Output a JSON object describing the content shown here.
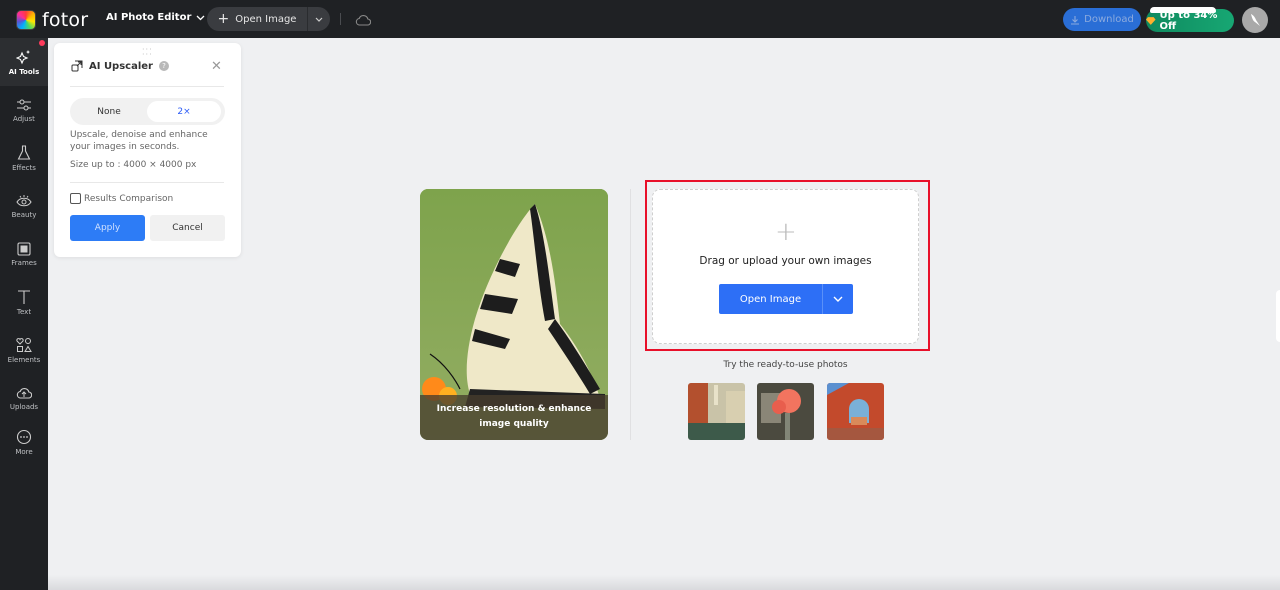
{
  "topbar": {
    "logo_text": "fotor",
    "app_menu_label": "AI Photo Editor",
    "open_image_label": "Open Image",
    "download_label": "Download",
    "promo_label": "Up to 34% Off",
    "icons": [
      "plus-icon",
      "chevron-down-icon",
      "cloud-icon",
      "download-icon",
      "diamond-icon",
      "avatar-bird-icon"
    ]
  },
  "sidebar": {
    "items": [
      {
        "label": "AI Tools",
        "icon": "sparkle-icon",
        "active": true
      },
      {
        "label": "Adjust",
        "icon": "sliders-icon"
      },
      {
        "label": "Effects",
        "icon": "flask-icon"
      },
      {
        "label": "Beauty",
        "icon": "eye-icon"
      },
      {
        "label": "Frames",
        "icon": "frame-icon"
      },
      {
        "label": "Text",
        "icon": "text-icon"
      },
      {
        "label": "Elements",
        "icon": "shapes-icon"
      },
      {
        "label": "Uploads",
        "icon": "cloud-upload-icon"
      },
      {
        "label": "More",
        "icon": "more-icon"
      }
    ]
  },
  "panel": {
    "title": "AI Upscaler",
    "help_glyph": "?",
    "options": [
      "None",
      "2×"
    ],
    "selected_option": "2×",
    "description": "Upscale, denoise and enhance your images in seconds.",
    "size_note": "Size up to : 4000 × 4000 px",
    "comparison_label": "Results Comparison",
    "comparison_checked": false,
    "apply_label": "Apply",
    "cancel_label": "Cancel"
  },
  "main": {
    "demo_caption": "Increase resolution & enhance image quality",
    "drop_text": "Drag or upload your own images",
    "open_image_label": "Open Image",
    "try_label": "Try the ready-to-use photos",
    "sample_photos": [
      "venice-canal",
      "pink-peonies",
      "red-archway"
    ]
  },
  "colors": {
    "accent_blue": "#2d6ff6",
    "highlight_red": "#e8102a",
    "promo_green": "#17a773",
    "topbar_bg": "#1f2124"
  }
}
